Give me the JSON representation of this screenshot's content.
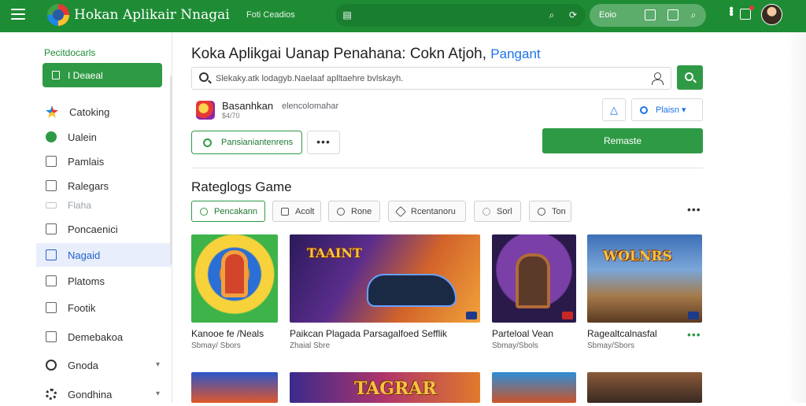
{
  "topbar": {
    "title": "Hokan Aplikair Nnagai",
    "link": "Foti Ceadios",
    "pill_label": "Eoio",
    "icons": [
      "menu-icon",
      "app-logo",
      "layout-icon",
      "search-icon",
      "refresh-icon",
      "grid-icon",
      "image-icon",
      "zoom-icon",
      "more-vertical-icon",
      "notification-icon",
      "avatar"
    ],
    "color": "#1e8c34"
  },
  "sidebar": {
    "heading": "Pecitdocarls",
    "primary_label": "I Deaeal",
    "items": [
      {
        "label": "Catoking",
        "icon": "star-icon"
      },
      {
        "label": "Ualein",
        "icon": "circle-check-icon"
      },
      {
        "label": "Pamlais",
        "icon": "file-icon"
      },
      {
        "label": "Ralegars",
        "icon": "calendar-icon"
      },
      {
        "label": "Flaha",
        "icon": "minus-icon"
      },
      {
        "label": "Poncaenici",
        "icon": "folder-icon"
      },
      {
        "label": "Nagaid",
        "icon": "tablet-icon"
      },
      {
        "label": "Platoms",
        "icon": "list-icon"
      },
      {
        "label": "Footik",
        "icon": "image-icon"
      },
      {
        "label": "Demebakoa",
        "icon": "document-icon"
      },
      {
        "label": "Gnoda",
        "icon": "circle-icon"
      },
      {
        "label": "Gondhina",
        "icon": "gear-icon"
      }
    ]
  },
  "main": {
    "title": "Koka Aplikgai Uanap Penahana: Cokn Atjoh,",
    "title_link": "Pangant",
    "search_placeholder": "Slekaky.atk lodagyb.Naelaaf aplltaehre bvlskayh.",
    "app": {
      "name": "Basanhkan",
      "developer": "elencolomahar",
      "sub": "$4/70"
    },
    "warn_symbol": "△",
    "select_label": "Plaisn ▾",
    "outline_button": "Pansianiantenrens",
    "more_button": "•••",
    "primary_button": "Remaste"
  },
  "section": {
    "title": "Rateglogs Game",
    "more": "•••",
    "chips": [
      "Pencakann",
      "Acolt",
      "Rone",
      "Rcentanoru",
      "Sorl",
      "Ton"
    ],
    "cards": [
      {
        "title": "Kanooe fe /Neals",
        "sub": "Sbmay/ Sbors",
        "art_text": ""
      },
      {
        "title": "Paikcan Plagada Parsagalfoed Sefflik",
        "sub": "Zhaial Sbre",
        "art_text": "TAAINT"
      },
      {
        "title": "Parteloal Vean",
        "sub": "Sbmay/Sbols",
        "art_text": ""
      },
      {
        "title": "Ragealtcalnasfal",
        "sub": "Sbmay/Sbors",
        "art_text": "WOLNRS"
      }
    ],
    "bottom_art_text": "TAGRAR",
    "card_more": "•••"
  }
}
